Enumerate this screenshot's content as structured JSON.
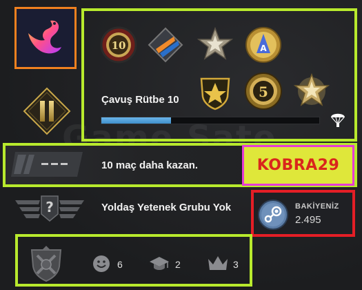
{
  "profile": {
    "avatar_icon": "phoenix-swan-icon",
    "rank_icon": "double-chevron-rank-icon"
  },
  "medals": [
    {
      "icon": "service-10-coin-icon"
    },
    {
      "icon": "operation-coin-icon"
    },
    {
      "icon": "silver-star-medal-icon"
    },
    {
      "icon": "gold-pin-icon"
    },
    {
      "icon": "gold-shield-medal-icon"
    },
    {
      "icon": "five-year-coin-icon"
    },
    {
      "icon": "gold-star-medal-icon"
    }
  ],
  "rank": {
    "name": "Çavuş Rütbe 10",
    "xp_progress": 0.32
  },
  "wins": {
    "text": "10 maç daha kazan."
  },
  "promo": {
    "text": "KOBRA29"
  },
  "skill": {
    "text": "Yoldaş Yetenek Grubu Yok"
  },
  "wallet": {
    "label": "BAKİYENİZ",
    "value": "2.495"
  },
  "stats": {
    "friendly": "6",
    "teacher": "2",
    "leader": "3"
  },
  "watermark": "Game Sate",
  "colors": {
    "highlight_green": "#b8ea2d",
    "highlight_orange": "#f0811f",
    "highlight_red": "#e41e26",
    "highlight_magenta": "#e63bd6",
    "promo_bg": "#dfe73a",
    "promo_text": "#d9261c",
    "xp_fill": "#4fa0dc"
  }
}
